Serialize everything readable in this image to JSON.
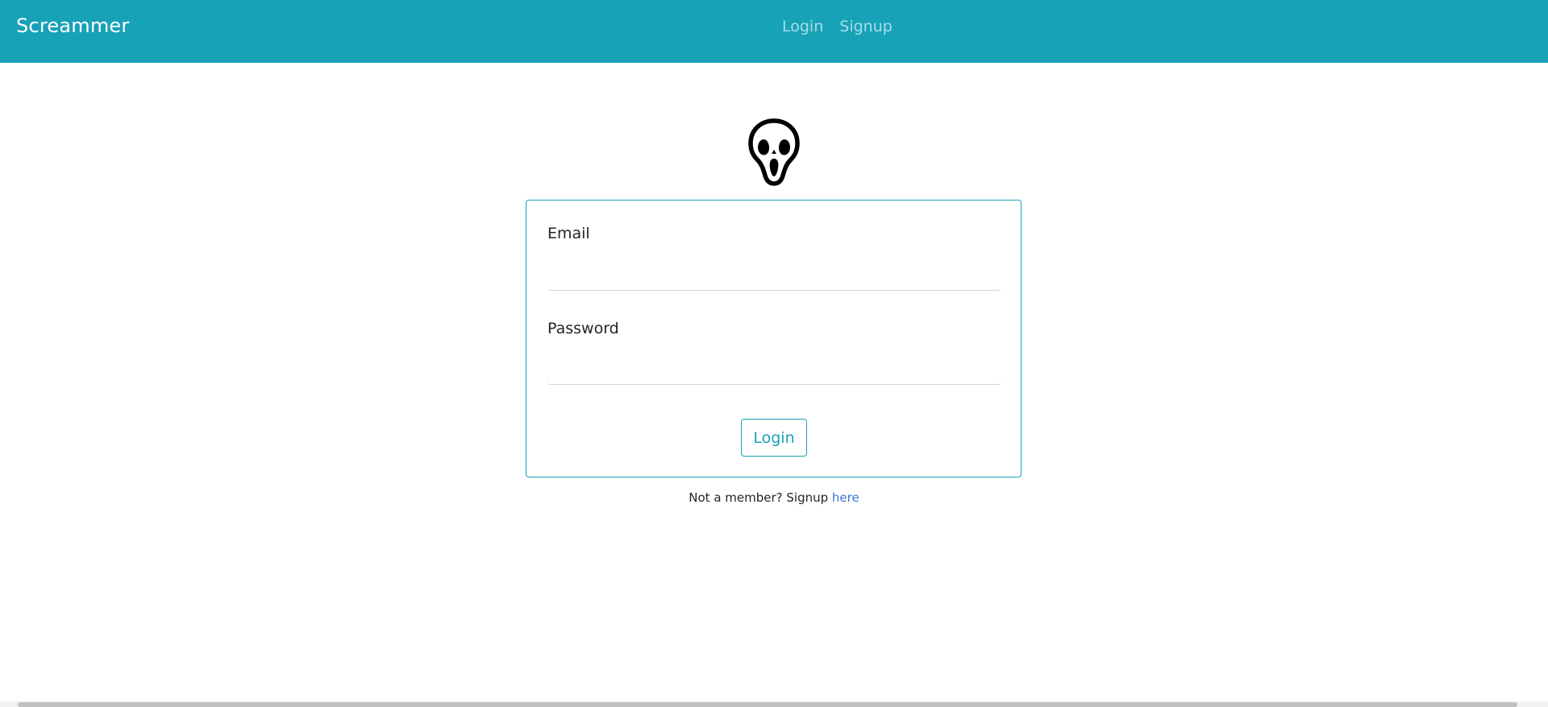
{
  "navbar": {
    "brand": "Screammer",
    "links": [
      {
        "label": "Login"
      },
      {
        "label": "Signup"
      }
    ]
  },
  "logo": {
    "icon": "ghostface-mask-icon"
  },
  "form": {
    "email": {
      "label": "Email",
      "value": "",
      "placeholder": ""
    },
    "password": {
      "label": "Password",
      "value": "",
      "placeholder": ""
    },
    "submit_label": "Login"
  },
  "signup_note": {
    "text": "Not a member? Signup ",
    "link": "here"
  },
  "colors": {
    "navbar_bg": "#17a2b8",
    "accent": "#17a2b8",
    "link": "#3a78d6"
  }
}
